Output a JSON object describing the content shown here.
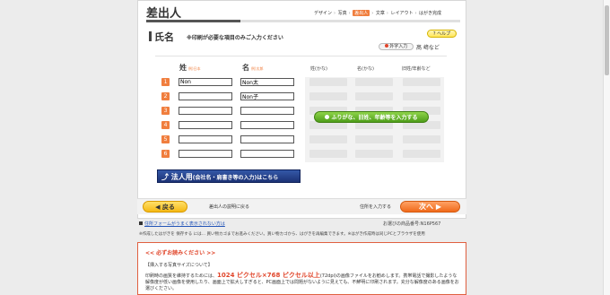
{
  "header": {
    "title": "差出人",
    "steps": [
      "デザイン",
      "写真",
      "差出人",
      "文章",
      "レイアウト",
      "はがき完成"
    ],
    "active_step": "差出人"
  },
  "section": {
    "title": "氏名",
    "note": "※印刷が必要な項目のみご入力ください",
    "help_label": "ヘルプ",
    "gaiji_label": "外字入力",
    "gaiji_example": "髙 﨑など"
  },
  "columns": {
    "sei_label": "姓",
    "sei_example": "例)日本",
    "mei_label": "名",
    "mei_example": "例)太郎",
    "sei_kana": "姓(かな)",
    "mei_kana": "名(かな)",
    "title_age": "旧姓/年齢など"
  },
  "rows": [
    {
      "num": "1",
      "sei": "Non",
      "mei": "Non太"
    },
    {
      "num": "2",
      "sei": "",
      "mei": "Non子"
    },
    {
      "num": "3",
      "sei": "",
      "mei": ""
    },
    {
      "num": "4",
      "sei": "",
      "mei": ""
    },
    {
      "num": "5",
      "sei": "",
      "mei": ""
    },
    {
      "num": "6",
      "sei": "",
      "mei": ""
    }
  ],
  "kana_button": "ふりがな、旧姓、年齢等を入力する",
  "corporate_button": {
    "main": "法人用",
    "sub": "(会社名・肩書き等の入力)はこちら"
  },
  "bottom": {
    "back_label": "戻る",
    "back_desc": "差出人の説明に戻る",
    "next_desc": "住所を入力する",
    "next_label": "次へ"
  },
  "footer": {
    "link": "住所フォームがうまく表示されない方は",
    "product_no": "お選びの商品番号:N16P567",
    "note": "※作成したはがきを 保存する には… 買い物カゴまでお進みください。買い物カゴから、はがきを再編集できます。※はがき作成時は同じPCとブラウザを使用"
  },
  "notice": {
    "title": "<< 必ずお読みください >>",
    "subtitle": "【挿入する写真サイズについて】",
    "body_prefix": "印刷時の画質を維持するためには、",
    "highlight": "1024 ピクセル×768 ピクセル以上",
    "body_suffix": "(72dpi)の画像ファイルをお勧めします。携帯電話で撮影したような解像度が低い画像を使用したり、画面上で拡大しすぎると、PC画面上では問題がないように見えても、不鮮明に印刷されます。充分な解像度のある画像をお選びください。"
  },
  "colors": {
    "accent": "#f07e3e",
    "green": "#4e9e1a",
    "navy": "#1c3275"
  }
}
